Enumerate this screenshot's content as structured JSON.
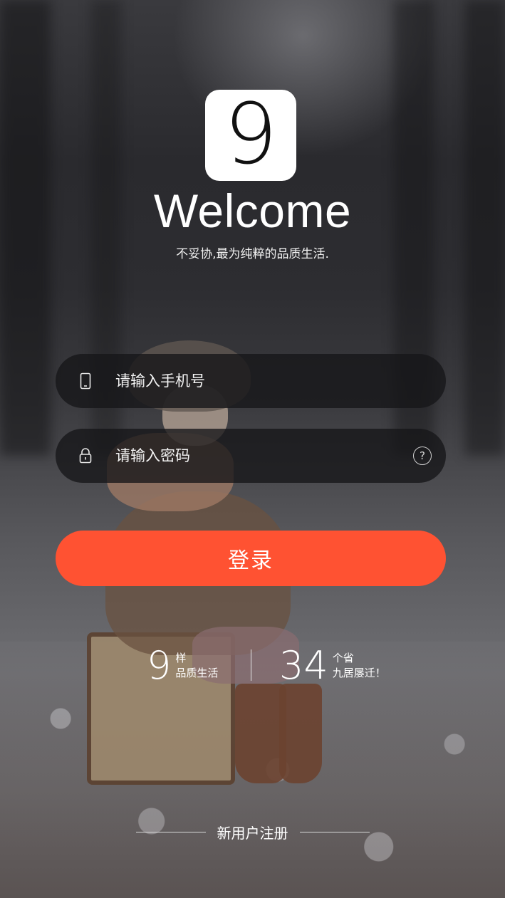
{
  "logo": {
    "glyph": "9"
  },
  "welcome": "Welcome",
  "tagline": "不妥协,最为纯粹的品质生活.",
  "phone_field": {
    "placeholder": "请输入手机号",
    "icon": "phone-icon"
  },
  "password_field": {
    "placeholder": "请输入密码",
    "icon": "lock-icon",
    "help_glyph": "?"
  },
  "login_button": {
    "label": "登录",
    "color": "#ff5232"
  },
  "stats": [
    {
      "number": "9",
      "line1": "样",
      "line2": "品质生活"
    },
    {
      "number": "34",
      "line1": "个省",
      "line2": "九居屡迁！"
    }
  ],
  "register_link": "新用户注册"
}
